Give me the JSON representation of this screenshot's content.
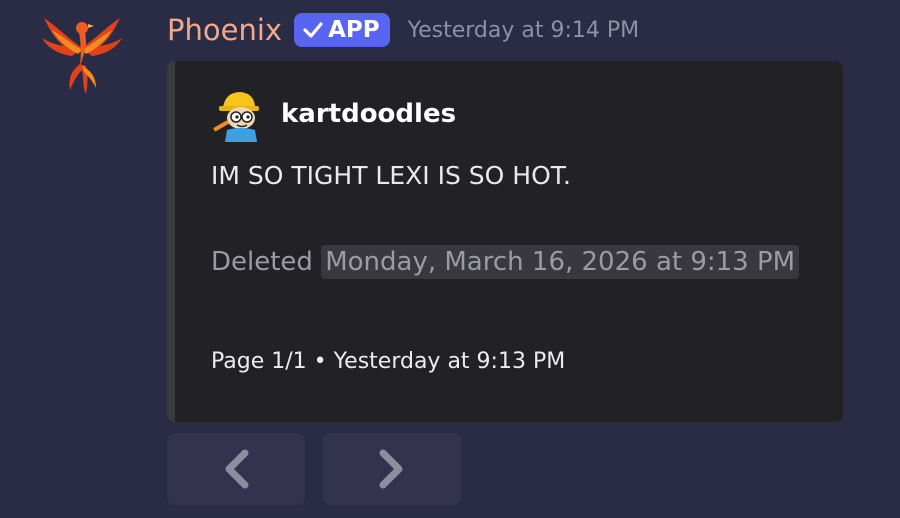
{
  "message": {
    "username": "Phoenix",
    "badge": "APP",
    "timestamp": "Yesterday at 9:14 PM",
    "avatar_icon": "phoenix-icon",
    "colors": {
      "username": "#f0a98c",
      "badge": "#5865f2",
      "background": "#2a2b45",
      "embed": "#222226"
    }
  },
  "embed": {
    "author_name": "kartdoodles",
    "author_avatar_icon": "cartoon-avatar-icon",
    "description": "IM SO TIGHT LEXI IS SO HOT.",
    "deleted_label": "Deleted",
    "deleted_date": "Monday, March 16, 2026 at 9:13 PM",
    "footer_page": "Page 1/1",
    "footer_separator": "•",
    "footer_time": "Yesterday at 9:13 PM"
  },
  "navigation": {
    "prev_icon": "chevron-left-icon",
    "next_icon": "chevron-right-icon"
  }
}
